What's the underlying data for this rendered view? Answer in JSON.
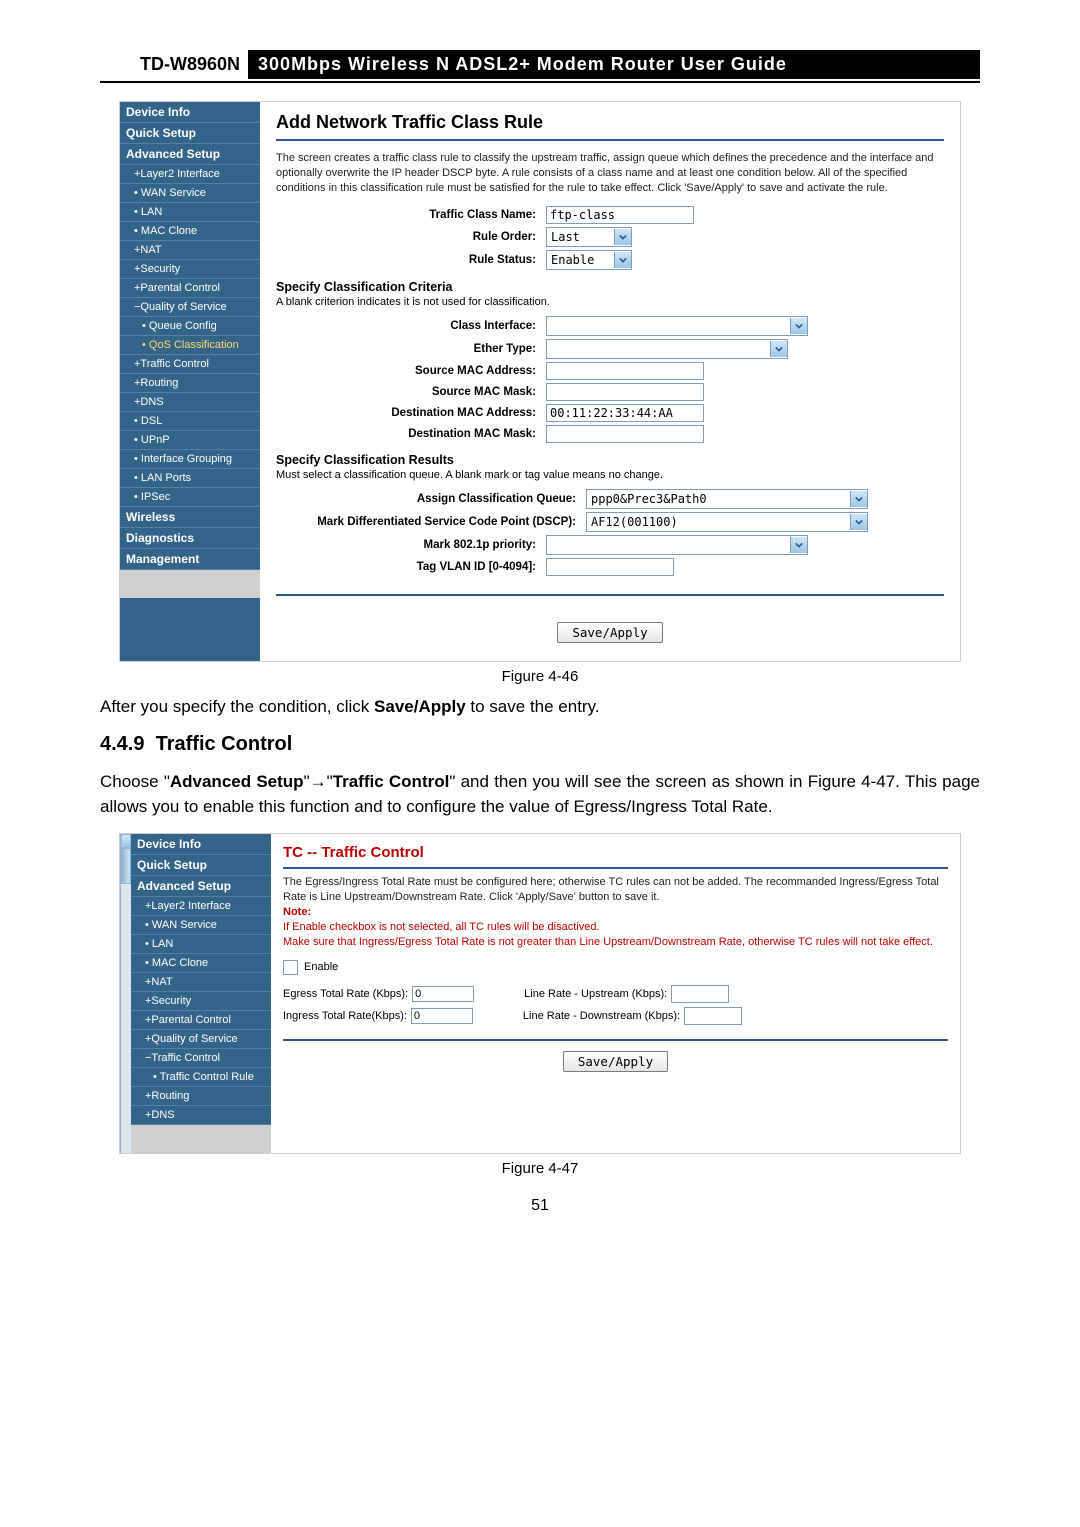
{
  "header": {
    "model": "TD-W8960N",
    "title": "300Mbps  Wireless  N  ADSL2+  Modem  Router  User  Guide"
  },
  "fig1": {
    "sidebar": [
      {
        "t": "Device Info",
        "c": "item"
      },
      {
        "t": "Quick Setup",
        "c": "item"
      },
      {
        "t": "Advanced Setup",
        "c": "item"
      },
      {
        "t": "+Layer2 Interface",
        "c": "item sub1"
      },
      {
        "t": "• WAN Service",
        "c": "item sub1"
      },
      {
        "t": "• LAN",
        "c": "item sub1"
      },
      {
        "t": "• MAC Clone",
        "c": "item sub1"
      },
      {
        "t": "+NAT",
        "c": "item sub1"
      },
      {
        "t": "+Security",
        "c": "item sub1"
      },
      {
        "t": "+Parental Control",
        "c": "item sub1"
      },
      {
        "t": "−Quality of Service",
        "c": "item sub1"
      },
      {
        "t": "• Queue Config",
        "c": "item sub2"
      },
      {
        "t": "• QoS Classification",
        "c": "item sub2 hl"
      },
      {
        "t": "+Traffic Control",
        "c": "item sub1"
      },
      {
        "t": "+Routing",
        "c": "item sub1"
      },
      {
        "t": "+DNS",
        "c": "item sub1"
      },
      {
        "t": "• DSL",
        "c": "item sub1"
      },
      {
        "t": "• UPnP",
        "c": "item sub1"
      },
      {
        "t": "• Interface Grouping",
        "c": "item sub1"
      },
      {
        "t": "• LAN Ports",
        "c": "item sub1"
      },
      {
        "t": "• IPSec",
        "c": "item sub1"
      },
      {
        "t": "Wireless",
        "c": "item"
      },
      {
        "t": "Diagnostics",
        "c": "item"
      },
      {
        "t": "Management",
        "c": "item"
      }
    ],
    "title": "Add Network Traffic Class Rule",
    "desc": "The screen creates a traffic class rule to classify the upstream traffic, assign queue which defines the precedence and the interface and optionally overwrite the IP header DSCP byte. A rule consists of a class name and at least one condition below. All of the specified conditions in this classification rule must be satisfied for the rule to take effect. Click 'Save/Apply' to save and activate the rule.",
    "fields": {
      "trafficClassName": {
        "label": "Traffic Class Name:",
        "value": "ftp-class"
      },
      "ruleOrder": {
        "label": "Rule Order:",
        "value": "Last"
      },
      "ruleStatus": {
        "label": "Rule Status:",
        "value": "Enable"
      }
    },
    "criteriaTitle": "Specify Classification Criteria",
    "criteriaNote": "A blank criterion indicates it is not used for classification.",
    "criteria": {
      "classInterface": {
        "label": "Class Interface:",
        "value": ""
      },
      "etherType": {
        "label": "Ether Type:",
        "value": ""
      },
      "srcMac": {
        "label": "Source MAC Address:",
        "value": ""
      },
      "srcMask": {
        "label": "Source MAC Mask:",
        "value": ""
      },
      "dstMac": {
        "label": "Destination MAC Address:",
        "value": "00:11:22:33:44:AA"
      },
      "dstMask": {
        "label": "Destination MAC Mask:",
        "value": ""
      }
    },
    "resultsTitle": "Specify Classification Results",
    "resultsNote": "Must select a classification queue. A blank mark or tag value means no change.",
    "results": {
      "assignQueue": {
        "label": "Assign Classification Queue:",
        "value": "ppp0&Prec3&Path0"
      },
      "dscp": {
        "label": "Mark Differentiated Service Code Point (DSCP):",
        "value": "AF12(001100)"
      },
      "p8021": {
        "label": "Mark 802.1p priority:",
        "value": ""
      },
      "vlan": {
        "label": "Tag VLAN ID [0-4094]:",
        "value": ""
      }
    },
    "button": "Save/Apply",
    "caption": "Figure 4-46"
  },
  "para1": {
    "pre": "After you specify the condition, click ",
    "bold": "Save/Apply",
    "post": " to save the entry."
  },
  "section": {
    "num": "4.4.9",
    "title": "Traffic Control"
  },
  "para2": {
    "p1": "Choose \"",
    "b1": "Advanced Setup",
    "arrow": "→",
    "q1": "\"",
    "b2": "Traffic Control",
    "rest": "\" and then you will see the screen as shown in Figure 4-47. This page allows you to enable this function and to configure the value of Egress/Ingress Total Rate."
  },
  "fig2": {
    "sidebar": [
      {
        "t": "Device Info",
        "c": "item"
      },
      {
        "t": "Quick Setup",
        "c": "item"
      },
      {
        "t": "Advanced Setup",
        "c": "item"
      },
      {
        "t": "+Layer2 Interface",
        "c": "item sub1"
      },
      {
        "t": "• WAN Service",
        "c": "item sub1"
      },
      {
        "t": "• LAN",
        "c": "item sub1"
      },
      {
        "t": "• MAC Clone",
        "c": "item sub1"
      },
      {
        "t": "+NAT",
        "c": "item sub1"
      },
      {
        "t": "+Security",
        "c": "item sub1"
      },
      {
        "t": "+Parental Control",
        "c": "item sub1"
      },
      {
        "t": "+Quality of Service",
        "c": "item sub1"
      },
      {
        "t": "−Traffic Control",
        "c": "item sub1"
      },
      {
        "t": "• Traffic Control Rule",
        "c": "item sub2"
      },
      {
        "t": "+Routing",
        "c": "item sub1"
      },
      {
        "t": "+DNS",
        "c": "item sub1"
      }
    ],
    "title": "TC -- Traffic Control",
    "desc1": "The Egress/Ingress Total Rate must be configured here; otherwise TC rules can not be added. The recommanded Ingress/Egress Total Rate is Line Upstream/Downstream Rate. Click 'Apply/Save' button to save it.",
    "noteLabel": "Note:",
    "note1": "If Enable checkbox is not selected, all TC rules will be disactived.",
    "note2": "Make sure that Ingress/Egress Total Rate is not greater than Line Upstream/Downstream Rate, otherwise TC rules will not take effect.",
    "enable": "Enable",
    "egressLabel": "Egress Total Rate (Kbps):",
    "egressVal": "0",
    "upLabel": "Line Rate - Upstream (Kbps):",
    "ingressLabel": "Ingress Total Rate(Kbps):",
    "ingressVal": "0",
    "downLabel": "Line Rate - Downstream (Kbps):",
    "button": "Save/Apply",
    "caption": "Figure 4-47"
  },
  "pageNum": "51"
}
